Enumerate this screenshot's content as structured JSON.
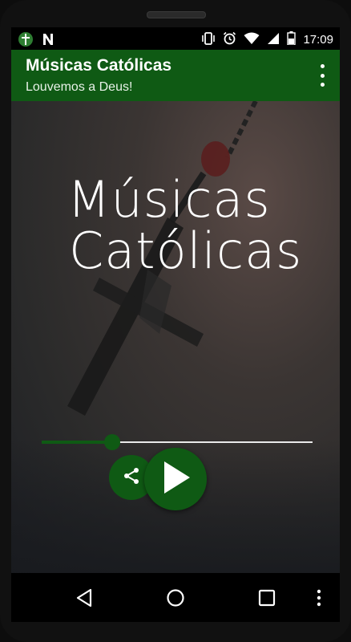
{
  "status_bar": {
    "left_icons": [
      "app-cross-icon",
      "n-notification-icon"
    ],
    "right_icons": [
      "vibrate-icon",
      "alarm-icon",
      "wifi-icon",
      "cellular-signal-icon",
      "battery-icon"
    ],
    "time": "17:09"
  },
  "app_bar": {
    "title": "Músicas Católicas",
    "subtitle": "Louvemos a Deus!",
    "menu_icon": "overflow-menu-icon"
  },
  "artwork": {
    "logo_line1": "Músicas",
    "logo_line2": "Católicas"
  },
  "player": {
    "progress": 0.26,
    "share_icon": "share-icon",
    "play_icon": "play-icon"
  },
  "nav_bar": {
    "icons": [
      "back-icon",
      "home-icon",
      "recents-icon",
      "more-icon"
    ]
  },
  "colors": {
    "primary": "#0f5a14",
    "status_bar": "#000000",
    "track": "#eaeaea"
  }
}
